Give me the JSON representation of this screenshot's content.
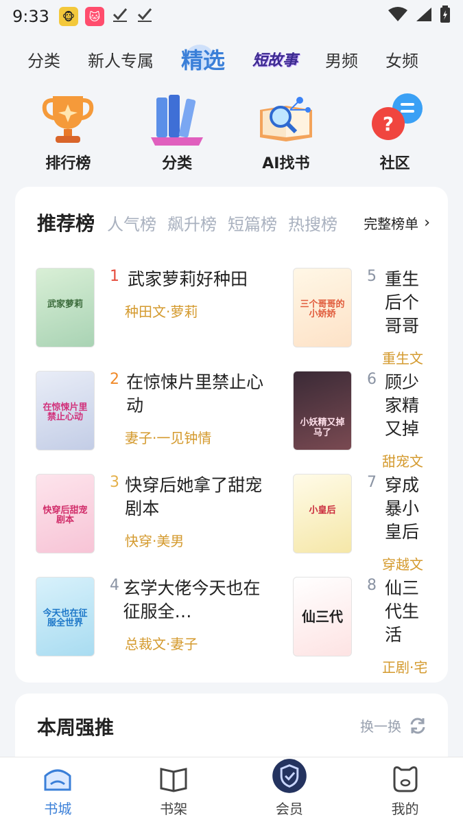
{
  "status_bar": {
    "time": "9:33"
  },
  "top_tabs": [
    {
      "label": "分类"
    },
    {
      "label": "新人专属"
    },
    {
      "label": "精选",
      "active": true
    },
    {
      "label": "短故事",
      "styled": true
    },
    {
      "label": "男频"
    },
    {
      "label": "女频"
    }
  ],
  "quick_entries": [
    {
      "label": "排行榜",
      "icon": "trophy-icon"
    },
    {
      "label": "分类",
      "icon": "books-icon"
    },
    {
      "label": "AI找书",
      "icon": "ai-search-icon"
    },
    {
      "label": "社区",
      "icon": "chat-bubbles-icon"
    }
  ],
  "rank": {
    "title": "推荐榜",
    "tabs": [
      "人气榜",
      "飙升榜",
      "短篇榜",
      "热搜榜"
    ],
    "full_label": "完整榜单",
    "items": [
      {
        "num": "1",
        "name": "武家萝莉好种田",
        "tags": "种田文·萝莉",
        "cover_text": "武家萝莉"
      },
      {
        "num": "2",
        "name": "在惊悚片里禁止心动",
        "tags": "妻子·一见钟情",
        "cover_text": "在惊悚片里禁止心动"
      },
      {
        "num": "3",
        "name": "快穿后她拿了甜宠剧本",
        "tags": "快穿·美男",
        "cover_text": "快穿后甜宠剧本"
      },
      {
        "num": "4",
        "name": "玄学大佬今天也在征服全…",
        "tags": "总裁文·妻子",
        "cover_text": "今天也在征服全世界"
      },
      {
        "num": "5",
        "name": "重生后个哥哥",
        "tags": "重生文",
        "cover_text": "三个哥哥的小娇娇"
      },
      {
        "num": "6",
        "name": "顾少家精又掉",
        "tags": "甜宠文",
        "cover_text": "小妖精又掉马了"
      },
      {
        "num": "7",
        "name": "穿成暴小皇后",
        "tags": "穿越文",
        "cover_text": "小皇后"
      },
      {
        "num": "8",
        "name": "仙三代生活",
        "tags": "正剧·宅",
        "cover_text": "仙三代"
      }
    ]
  },
  "weekly": {
    "title": "本周强推",
    "refresh_label": "换一换"
  },
  "bottom_nav": [
    {
      "label": "书城",
      "icon": "bookstore-icon",
      "active": true
    },
    {
      "label": "书架",
      "icon": "bookshelf-icon"
    },
    {
      "label": "会员",
      "icon": "vip-shield-icon"
    },
    {
      "label": "我的",
      "icon": "profile-icon"
    }
  ],
  "colors": {
    "accent": "#3a7fd8",
    "rank_red": "#e64b3c",
    "rank_orange": "#f08a2a",
    "rank_gold": "#e4b04a",
    "rank_gray": "#8a93a3",
    "tag": "#d49a2e"
  }
}
